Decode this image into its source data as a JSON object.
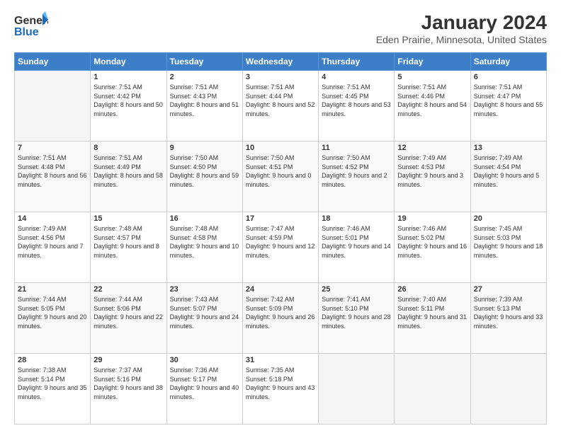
{
  "header": {
    "logo_line1": "General",
    "logo_line2": "Blue",
    "month": "January 2024",
    "location": "Eden Prairie, Minnesota, United States"
  },
  "weekdays": [
    "Sunday",
    "Monday",
    "Tuesday",
    "Wednesday",
    "Thursday",
    "Friday",
    "Saturday"
  ],
  "weeks": [
    [
      {
        "day": "",
        "empty": true
      },
      {
        "day": "1",
        "sunrise": "7:51 AM",
        "sunset": "4:42 PM",
        "daylight": "8 hours and 50 minutes."
      },
      {
        "day": "2",
        "sunrise": "7:51 AM",
        "sunset": "4:43 PM",
        "daylight": "8 hours and 51 minutes."
      },
      {
        "day": "3",
        "sunrise": "7:51 AM",
        "sunset": "4:44 PM",
        "daylight": "8 hours and 52 minutes."
      },
      {
        "day": "4",
        "sunrise": "7:51 AM",
        "sunset": "4:45 PM",
        "daylight": "8 hours and 53 minutes."
      },
      {
        "day": "5",
        "sunrise": "7:51 AM",
        "sunset": "4:46 PM",
        "daylight": "8 hours and 54 minutes."
      },
      {
        "day": "6",
        "sunrise": "7:51 AM",
        "sunset": "4:47 PM",
        "daylight": "8 hours and 55 minutes."
      }
    ],
    [
      {
        "day": "7",
        "sunrise": "7:51 AM",
        "sunset": "4:48 PM",
        "daylight": "8 hours and 56 minutes."
      },
      {
        "day": "8",
        "sunrise": "7:51 AM",
        "sunset": "4:49 PM",
        "daylight": "8 hours and 58 minutes."
      },
      {
        "day": "9",
        "sunrise": "7:50 AM",
        "sunset": "4:50 PM",
        "daylight": "8 hours and 59 minutes."
      },
      {
        "day": "10",
        "sunrise": "7:50 AM",
        "sunset": "4:51 PM",
        "daylight": "9 hours and 0 minutes."
      },
      {
        "day": "11",
        "sunrise": "7:50 AM",
        "sunset": "4:52 PM",
        "daylight": "9 hours and 2 minutes."
      },
      {
        "day": "12",
        "sunrise": "7:49 AM",
        "sunset": "4:53 PM",
        "daylight": "9 hours and 3 minutes."
      },
      {
        "day": "13",
        "sunrise": "7:49 AM",
        "sunset": "4:54 PM",
        "daylight": "9 hours and 5 minutes."
      }
    ],
    [
      {
        "day": "14",
        "sunrise": "7:49 AM",
        "sunset": "4:56 PM",
        "daylight": "9 hours and 7 minutes."
      },
      {
        "day": "15",
        "sunrise": "7:48 AM",
        "sunset": "4:57 PM",
        "daylight": "9 hours and 8 minutes."
      },
      {
        "day": "16",
        "sunrise": "7:48 AM",
        "sunset": "4:58 PM",
        "daylight": "9 hours and 10 minutes."
      },
      {
        "day": "17",
        "sunrise": "7:47 AM",
        "sunset": "4:59 PM",
        "daylight": "9 hours and 12 minutes."
      },
      {
        "day": "18",
        "sunrise": "7:46 AM",
        "sunset": "5:01 PM",
        "daylight": "9 hours and 14 minutes."
      },
      {
        "day": "19",
        "sunrise": "7:46 AM",
        "sunset": "5:02 PM",
        "daylight": "9 hours and 16 minutes."
      },
      {
        "day": "20",
        "sunrise": "7:45 AM",
        "sunset": "5:03 PM",
        "daylight": "9 hours and 18 minutes."
      }
    ],
    [
      {
        "day": "21",
        "sunrise": "7:44 AM",
        "sunset": "5:05 PM",
        "daylight": "9 hours and 20 minutes."
      },
      {
        "day": "22",
        "sunrise": "7:44 AM",
        "sunset": "5:06 PM",
        "daylight": "9 hours and 22 minutes."
      },
      {
        "day": "23",
        "sunrise": "7:43 AM",
        "sunset": "5:07 PM",
        "daylight": "9 hours and 24 minutes."
      },
      {
        "day": "24",
        "sunrise": "7:42 AM",
        "sunset": "5:09 PM",
        "daylight": "9 hours and 26 minutes."
      },
      {
        "day": "25",
        "sunrise": "7:41 AM",
        "sunset": "5:10 PM",
        "daylight": "9 hours and 28 minutes."
      },
      {
        "day": "26",
        "sunrise": "7:40 AM",
        "sunset": "5:11 PM",
        "daylight": "9 hours and 31 minutes."
      },
      {
        "day": "27",
        "sunrise": "7:39 AM",
        "sunset": "5:13 PM",
        "daylight": "9 hours and 33 minutes."
      }
    ],
    [
      {
        "day": "28",
        "sunrise": "7:38 AM",
        "sunset": "5:14 PM",
        "daylight": "9 hours and 35 minutes."
      },
      {
        "day": "29",
        "sunrise": "7:37 AM",
        "sunset": "5:16 PM",
        "daylight": "9 hours and 38 minutes."
      },
      {
        "day": "30",
        "sunrise": "7:36 AM",
        "sunset": "5:17 PM",
        "daylight": "9 hours and 40 minutes."
      },
      {
        "day": "31",
        "sunrise": "7:35 AM",
        "sunset": "5:18 PM",
        "daylight": "9 hours and 43 minutes."
      },
      {
        "day": "",
        "empty": true
      },
      {
        "day": "",
        "empty": true
      },
      {
        "day": "",
        "empty": true
      }
    ]
  ],
  "labels": {
    "sunrise_prefix": "Sunrise: ",
    "sunset_prefix": "Sunset: ",
    "daylight_prefix": "Daylight: "
  }
}
